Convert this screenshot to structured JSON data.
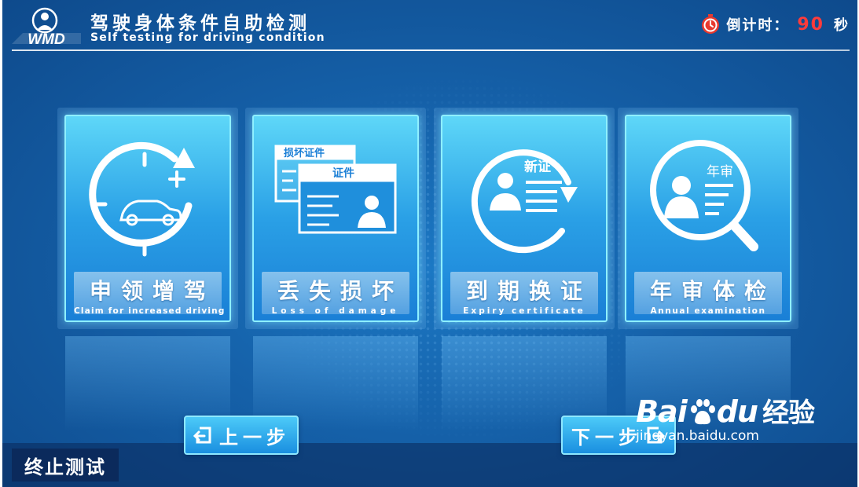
{
  "header": {
    "logo_text": "WMD",
    "title_cn": "驾驶身体条件自助检测",
    "title_en": "Self testing for driving condition",
    "countdown_label": "倒计时：",
    "countdown_value": "90",
    "countdown_unit": "秒"
  },
  "cards": [
    {
      "title_cn": "申领增驾",
      "title_en": "Claim for increased driving",
      "icon": "add-driving-icon"
    },
    {
      "title_cn": "丢失损坏",
      "title_en": "Loss of damage",
      "icon": "lost-certificate-icon",
      "doc_back": "损坏证件",
      "doc_front": "证件"
    },
    {
      "title_cn": "到期换证",
      "title_en": "Expiry certificate",
      "icon": "renew-certificate-icon",
      "doc_label": "新证"
    },
    {
      "title_cn": "年审体检",
      "title_en": "Annual examination",
      "icon": "annual-check-icon",
      "doc_label": "年审"
    }
  ],
  "nav": {
    "prev_label": "上一步",
    "next_label": "下一步",
    "stop_label": "终止测试"
  },
  "watermark": {
    "brand": "Bai",
    "brand2": "du",
    "brand_cn": "经验",
    "url": "jingyan.baidu.com"
  },
  "colors": {
    "accent_red": "#ff3b3b",
    "card_top": "#5ed7f8",
    "card_bottom": "#1a7fd6"
  }
}
